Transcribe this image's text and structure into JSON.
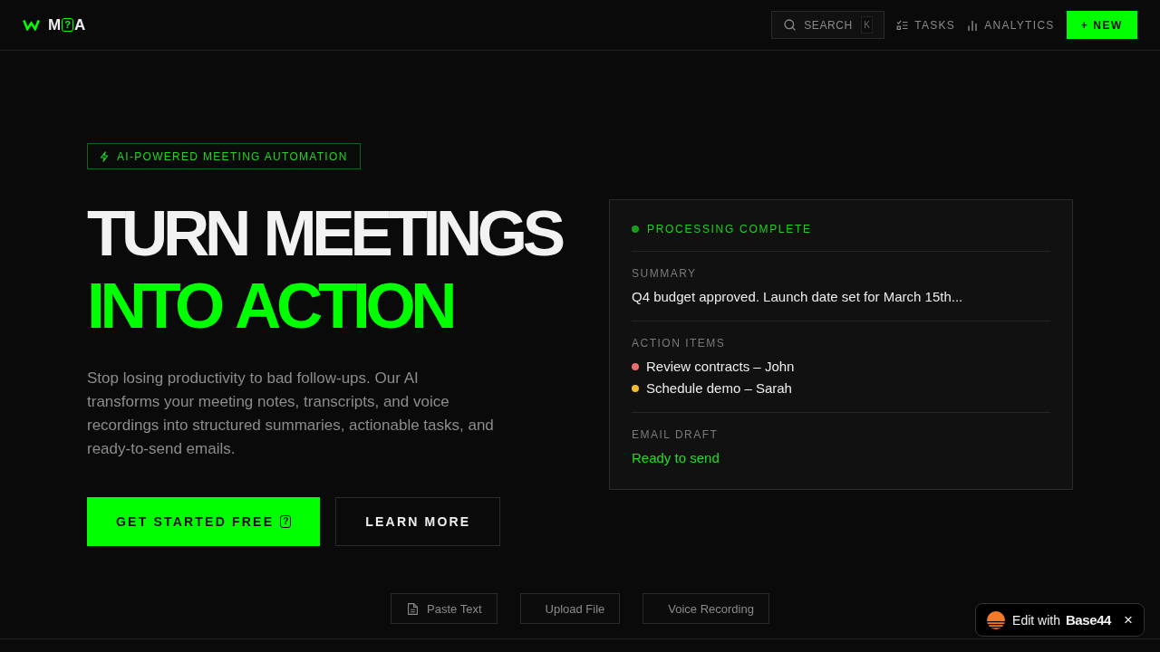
{
  "header": {
    "logo": {
      "before": "M",
      "boxed": "?",
      "after": "A"
    },
    "search": {
      "label": "SEARCH",
      "shortcut": "K"
    },
    "nav": [
      {
        "label": "TASKS",
        "kind": "tasks"
      },
      {
        "label": "ANALYTICS",
        "kind": "analytics"
      }
    ],
    "new_button": "+ NEW"
  },
  "hero": {
    "badge": "AI-POWERED MEETING AUTOMATION",
    "headline": "TURN MEETINGS",
    "headline_accent": "INTO ACTION",
    "description": "Stop losing productivity to bad follow-ups. Our AI transforms your meeting notes, transcripts, and voice recordings into structured summaries, actionable tasks, and ready-to-send emails.",
    "primary_button": {
      "label": "GET STARTED FREE",
      "glyph": "?"
    },
    "secondary_button": "LEARN MORE"
  },
  "preview_card": {
    "status": "PROCESSING COMPLETE",
    "summary": {
      "label": "SUMMARY",
      "text": "Q4 budget approved. Launch date set for March 15th..."
    },
    "action_items": {
      "label": "ACTION ITEMS",
      "items": [
        {
          "text": "Review contracts – John",
          "color": "#ea6b6b"
        },
        {
          "text": "Schedule demo – Sarah",
          "color": "#f5b82e"
        }
      ]
    },
    "email_draft": {
      "label": "EMAIL DRAFT",
      "status": "Ready to send"
    }
  },
  "input_options": [
    {
      "label": "Paste Text",
      "kind": "file"
    },
    {
      "label": "Upload File",
      "kind": "plain"
    },
    {
      "label": "Voice Recording",
      "kind": "plain"
    }
  ],
  "edit_badge": {
    "label": "Edit with **Base44**",
    "close": "×"
  }
}
